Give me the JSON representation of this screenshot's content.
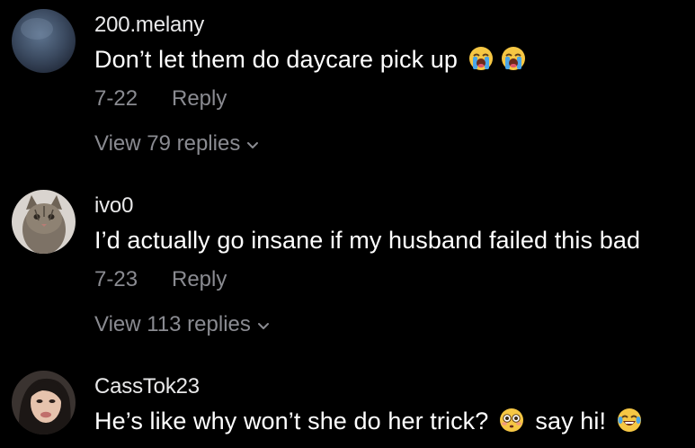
{
  "comments": [
    {
      "username": "200.melany",
      "text": "Don’t let them do daycare pick up",
      "emojis": [
        "loudly-crying-face-icon",
        "loudly-crying-face-icon"
      ],
      "date": "7-22",
      "reply_label": "Reply",
      "view_replies": "View 79 replies"
    },
    {
      "username": "ivo0",
      "text": "I’d actually go insane if my husband failed this bad",
      "date": "7-23",
      "reply_label": "Reply",
      "view_replies": "View 113 replies"
    },
    {
      "username": "CassTok23",
      "text_part1": "He’s like why won’t she do her trick?",
      "emoji1": "flushed-face-icon",
      "text_part2": "say hi!",
      "emoji2": "face-with-tears-of-joy-icon"
    }
  ],
  "colors": {
    "background": "#000000",
    "primary_text": "#ffffff",
    "secondary_text": "#8a8b91"
  }
}
